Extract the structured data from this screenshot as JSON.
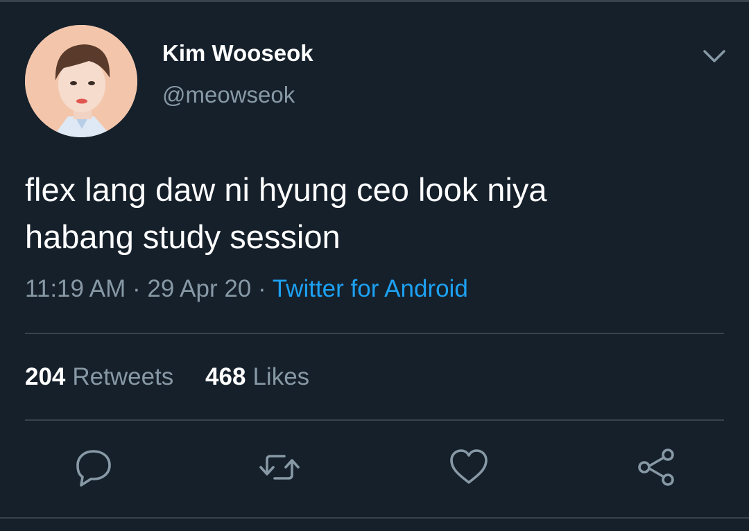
{
  "tweet": {
    "author": {
      "display_name": "Kim Wooseok",
      "handle": "@meowseok"
    },
    "text_lines": [
      "flex lang daw ni hyung ceo look niya",
      "habang study session"
    ],
    "time": "11:19 AM",
    "date": "29 Apr 20",
    "separator": "·",
    "source": "Twitter for Android",
    "stats": {
      "retweets": {
        "count": "204",
        "label": "Retweets"
      },
      "likes": {
        "count": "468",
        "label": "Likes"
      }
    }
  },
  "icons": {
    "menu": "chevron-down-icon",
    "reply": "reply-icon",
    "retweet": "retweet-icon",
    "like": "heart-icon",
    "share": "share-icon"
  },
  "colors": {
    "background": "#15202b",
    "divider": "#38444d",
    "primary_text": "#ffffff",
    "secondary_text": "#8899a6",
    "accent": "#1da1f2"
  }
}
